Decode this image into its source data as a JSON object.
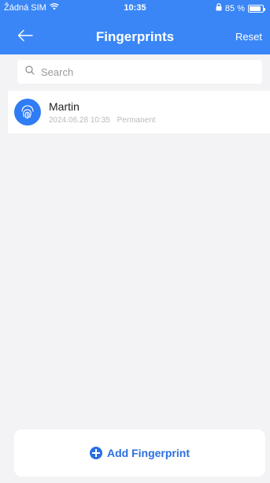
{
  "status_bar": {
    "carrier": "Žádná SIM",
    "time": "10:35",
    "battery": "85 %",
    "icons": [
      "wifi-icon",
      "lock-rotation-icon",
      "battery-icon"
    ]
  },
  "nav": {
    "title": "Fingerprints",
    "reset_label": "Reset",
    "back_icon": "arrow-left-icon"
  },
  "search": {
    "placeholder": "Search",
    "value": ""
  },
  "fingerprints": [
    {
      "name": "Martin",
      "date": "2024.06.28 10:35",
      "validity": "Permanent",
      "icon": "fingerprint-icon"
    }
  ],
  "footer": {
    "add_label": "Add Fingerprint",
    "add_icon": "plus-circle-icon"
  },
  "colors": {
    "accent": "#3a86f6",
    "background": "#f3f3f5",
    "button_text": "#2a6fe0"
  }
}
